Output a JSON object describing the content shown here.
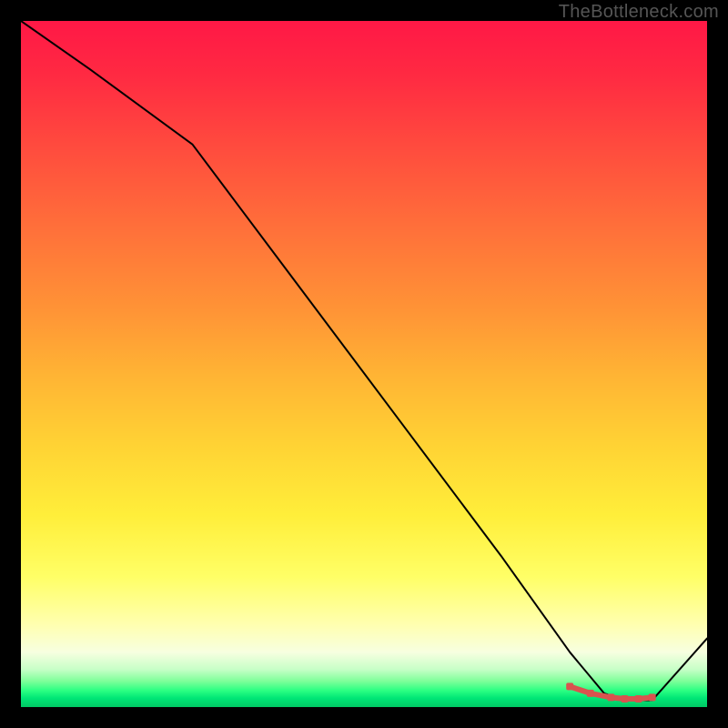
{
  "watermark": "TheBottleneck.com",
  "chart_data": {
    "type": "line",
    "title": "",
    "xlabel": "",
    "ylabel": "",
    "xlim": [
      0,
      100
    ],
    "ylim": [
      0,
      100
    ],
    "grid": false,
    "legend": false,
    "series": [
      {
        "name": "bottleneck-curve",
        "color": "#000000",
        "x": [
          0,
          10,
          25,
          40,
          55,
          70,
          80,
          85,
          88,
          92,
          100
        ],
        "y": [
          100,
          93,
          82,
          62,
          42,
          22,
          8,
          2,
          1,
          1,
          10
        ]
      }
    ],
    "markers": {
      "name": "highlight-segment",
      "color": "#d9534f",
      "x": [
        80,
        83,
        86,
        88,
        90,
        92
      ],
      "y": [
        3.0,
        2.0,
        1.4,
        1.2,
        1.2,
        1.4
      ]
    }
  }
}
